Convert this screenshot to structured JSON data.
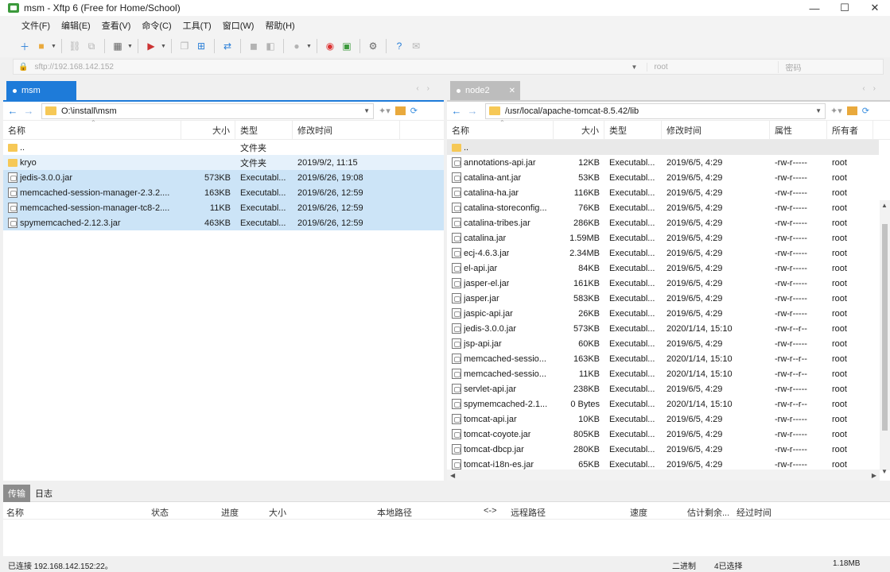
{
  "window": {
    "title": "msm - Xftp 6 (Free for Home/School)",
    "minimize": "—",
    "maximize": "☐",
    "close": "✕"
  },
  "menu": [
    "文件(F)",
    "编辑(E)",
    "查看(V)",
    "命令(C)",
    "工具(T)",
    "窗口(W)",
    "帮助(H)"
  ],
  "toolbar_icons": [
    "new-session-icon",
    "open-folder-icon",
    "link-icon",
    "unlink-icon",
    "layout-icon",
    "media-icon",
    "copy-icon",
    "paste-icon",
    "transfer-icon",
    "stop-icon",
    "disconnect-icon",
    "globe-icon",
    "xshell-icon",
    "xftp-icon",
    "settings-icon",
    "help-icon",
    "chat-icon"
  ],
  "address": {
    "lock": "🔒",
    "host_placeholder": "sftp://192.168.142.152",
    "user_placeholder": "root",
    "pass_placeholder": "密码"
  },
  "left": {
    "tab_label": "msm",
    "path": "O:\\install\\msm",
    "headers": {
      "name": "名称",
      "size": "大小",
      "type": "类型",
      "modified": "修改时间"
    },
    "rows": [
      {
        "icon": "folder",
        "name": "..",
        "size": "",
        "type": "文件夹",
        "modified": "",
        "selected": false,
        "hover": false
      },
      {
        "icon": "folder",
        "name": "kryo",
        "size": "",
        "type": "文件夹",
        "modified": "2019/9/2, 11:15",
        "selected": false,
        "hover": true
      },
      {
        "icon": "jar",
        "name": "jedis-3.0.0.jar",
        "size": "573KB",
        "type": "Executabl...",
        "modified": "2019/6/26, 19:08",
        "selected": true,
        "hover": false
      },
      {
        "icon": "jar",
        "name": "memcached-session-manager-2.3.2....",
        "size": "163KB",
        "type": "Executabl...",
        "modified": "2019/6/26, 12:59",
        "selected": true,
        "hover": false
      },
      {
        "icon": "jar",
        "name": "memcached-session-manager-tc8-2....",
        "size": "11KB",
        "type": "Executabl...",
        "modified": "2019/6/26, 12:59",
        "selected": true,
        "hover": false
      },
      {
        "icon": "jar",
        "name": "spymemcached-2.12.3.jar",
        "size": "463KB",
        "type": "Executabl...",
        "modified": "2019/6/26, 12:59",
        "selected": true,
        "hover": false
      }
    ]
  },
  "right": {
    "tab_label": "node2",
    "path": "/usr/local/apache-tomcat-8.5.42/lib",
    "headers": {
      "name": "名称",
      "size": "大小",
      "type": "类型",
      "modified": "修改时间",
      "attr": "属性",
      "owner": "所有者"
    },
    "rows": [
      {
        "icon": "folder",
        "name": "..",
        "size": "",
        "type": "",
        "modified": "",
        "attr": "",
        "owner": ""
      },
      {
        "icon": "jar",
        "name": "annotations-api.jar",
        "size": "12KB",
        "type": "Executabl...",
        "modified": "2019/6/5, 4:29",
        "attr": "-rw-r-----",
        "owner": "root"
      },
      {
        "icon": "jar",
        "name": "catalina-ant.jar",
        "size": "53KB",
        "type": "Executabl...",
        "modified": "2019/6/5, 4:29",
        "attr": "-rw-r-----",
        "owner": "root"
      },
      {
        "icon": "jar",
        "name": "catalina-ha.jar",
        "size": "116KB",
        "type": "Executabl...",
        "modified": "2019/6/5, 4:29",
        "attr": "-rw-r-----",
        "owner": "root"
      },
      {
        "icon": "jar",
        "name": "catalina-storeconfig...",
        "size": "76KB",
        "type": "Executabl...",
        "modified": "2019/6/5, 4:29",
        "attr": "-rw-r-----",
        "owner": "root"
      },
      {
        "icon": "jar",
        "name": "catalina-tribes.jar",
        "size": "286KB",
        "type": "Executabl...",
        "modified": "2019/6/5, 4:29",
        "attr": "-rw-r-----",
        "owner": "root"
      },
      {
        "icon": "jar",
        "name": "catalina.jar",
        "size": "1.59MB",
        "type": "Executabl...",
        "modified": "2019/6/5, 4:29",
        "attr": "-rw-r-----",
        "owner": "root"
      },
      {
        "icon": "jar",
        "name": "ecj-4.6.3.jar",
        "size": "2.34MB",
        "type": "Executabl...",
        "modified": "2019/6/5, 4:29",
        "attr": "-rw-r-----",
        "owner": "root"
      },
      {
        "icon": "jar",
        "name": "el-api.jar",
        "size": "84KB",
        "type": "Executabl...",
        "modified": "2019/6/5, 4:29",
        "attr": "-rw-r-----",
        "owner": "root"
      },
      {
        "icon": "jar",
        "name": "jasper-el.jar",
        "size": "161KB",
        "type": "Executabl...",
        "modified": "2019/6/5, 4:29",
        "attr": "-rw-r-----",
        "owner": "root"
      },
      {
        "icon": "jar",
        "name": "jasper.jar",
        "size": "583KB",
        "type": "Executabl...",
        "modified": "2019/6/5, 4:29",
        "attr": "-rw-r-----",
        "owner": "root"
      },
      {
        "icon": "jar",
        "name": "jaspic-api.jar",
        "size": "26KB",
        "type": "Executabl...",
        "modified": "2019/6/5, 4:29",
        "attr": "-rw-r-----",
        "owner": "root"
      },
      {
        "icon": "jar",
        "name": "jedis-3.0.0.jar",
        "size": "573KB",
        "type": "Executabl...",
        "modified": "2020/1/14, 15:10",
        "attr": "-rw-r--r--",
        "owner": "root"
      },
      {
        "icon": "jar",
        "name": "jsp-api.jar",
        "size": "60KB",
        "type": "Executabl...",
        "modified": "2019/6/5, 4:29",
        "attr": "-rw-r-----",
        "owner": "root"
      },
      {
        "icon": "jar",
        "name": "memcached-sessio...",
        "size": "163KB",
        "type": "Executabl...",
        "modified": "2020/1/14, 15:10",
        "attr": "-rw-r--r--",
        "owner": "root"
      },
      {
        "icon": "jar",
        "name": "memcached-sessio...",
        "size": "11KB",
        "type": "Executabl...",
        "modified": "2020/1/14, 15:10",
        "attr": "-rw-r--r--",
        "owner": "root"
      },
      {
        "icon": "jar",
        "name": "servlet-api.jar",
        "size": "238KB",
        "type": "Executabl...",
        "modified": "2019/6/5, 4:29",
        "attr": "-rw-r-----",
        "owner": "root"
      },
      {
        "icon": "jar",
        "name": "spymemcached-2.1...",
        "size": "0 Bytes",
        "type": "Executabl...",
        "modified": "2020/1/14, 15:10",
        "attr": "-rw-r--r--",
        "owner": "root"
      },
      {
        "icon": "jar",
        "name": "tomcat-api.jar",
        "size": "10KB",
        "type": "Executabl...",
        "modified": "2019/6/5, 4:29",
        "attr": "-rw-r-----",
        "owner": "root"
      },
      {
        "icon": "jar",
        "name": "tomcat-coyote.jar",
        "size": "805KB",
        "type": "Executabl...",
        "modified": "2019/6/5, 4:29",
        "attr": "-rw-r-----",
        "owner": "root"
      },
      {
        "icon": "jar",
        "name": "tomcat-dbcp.jar",
        "size": "280KB",
        "type": "Executabl...",
        "modified": "2019/6/5, 4:29",
        "attr": "-rw-r-----",
        "owner": "root"
      },
      {
        "icon": "jar",
        "name": "tomcat-i18n-es.jar",
        "size": "65KB",
        "type": "Executabl...",
        "modified": "2019/6/5, 4:29",
        "attr": "-rw-r-----",
        "owner": "root"
      }
    ]
  },
  "transfers": {
    "tabs": [
      "传输",
      "日志"
    ],
    "headers": {
      "name": "名称",
      "status": "状态",
      "progress": "进度",
      "size": "大小",
      "local": "本地路径",
      "arrow": "<->",
      "remote": "远程路径",
      "speed": "速度",
      "eta": "估计剩余...",
      "elapsed": "经过时间"
    }
  },
  "status": {
    "connection": "已连接 192.168.142.152:22。",
    "mode": "二进制",
    "selected": "4已选择",
    "total": "1.18MB"
  }
}
